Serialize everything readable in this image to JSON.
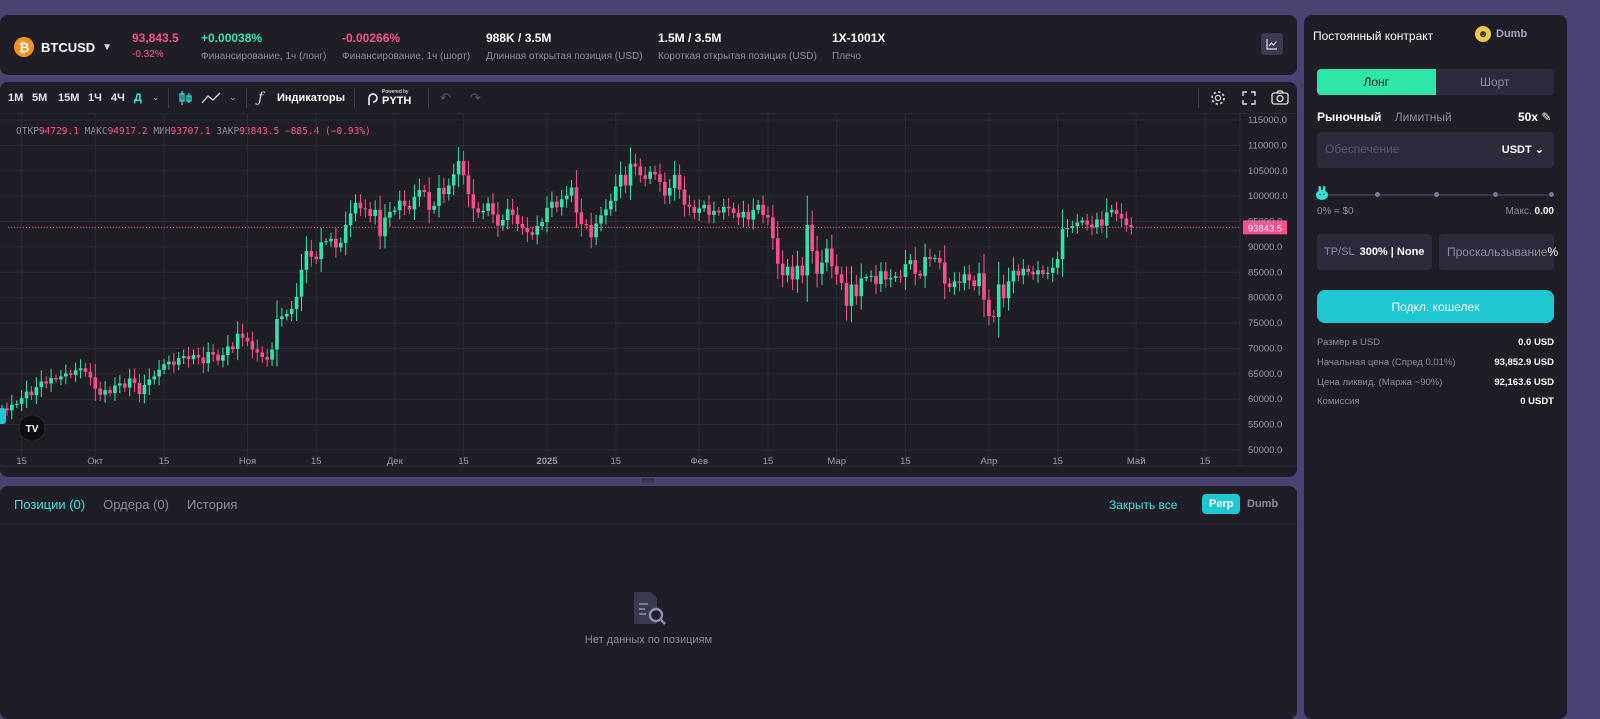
{
  "topbar": {
    "symbol": "BTCUSD",
    "price": "93,843.5",
    "change": "-0.32%",
    "funding_long": {
      "value": "+0.00038%",
      "label": "Финансирование, 1ч (лонг)"
    },
    "funding_short": {
      "value": "-0.00266%",
      "label": "Финансирование, 1ч (шорт)"
    },
    "long_oi": {
      "value": "988K / 3.5M",
      "label": "Длинная открытая позиция (USD)"
    },
    "short_oi": {
      "value": "1.5M / 3.5M",
      "label": "Короткая открытая позиция (USD)"
    },
    "leverage": {
      "value": "1X-1001X",
      "label": "Плечо"
    }
  },
  "toolbar": {
    "timeframes": [
      "1M",
      "5M",
      "15M",
      "1Ч",
      "4Ч",
      "Д"
    ],
    "active_timeframe": "Д",
    "indicators": "Индикаторы",
    "powered_by": "Powered by",
    "pyth": "PYTH"
  },
  "ohlc": {
    "o_label": "ОТКР",
    "o": "94729.1",
    "h_label": "МАКС",
    "h": "94917.2",
    "l_label": "МИН",
    "l": "93707.1",
    "c_label": "ЗАКР",
    "c": "93843.5",
    "chg": "−885.4 (−0.93%)"
  },
  "colors": {
    "up": "#2ee6a8",
    "down": "#ff4f8b",
    "accent": "#1ec8d2"
  },
  "chart_data": {
    "type": "candlestick",
    "price_label": "93843.5",
    "ylim": [
      50000,
      115000
    ],
    "y_ticks": [
      "115000.0",
      "110000.0",
      "105000.0",
      "100000.0",
      "95000.0",
      "90000.0",
      "85000.0",
      "80000.0",
      "75000.0",
      "70000.0",
      "65000.0",
      "60000.0",
      "55000.0",
      "50000.0"
    ],
    "x_ticks": [
      {
        "label": "15",
        "i": 4
      },
      {
        "label": "Окт",
        "i": 19
      },
      {
        "label": "15",
        "i": 33
      },
      {
        "label": "Ноя",
        "i": 50
      },
      {
        "label": "15",
        "i": 64
      },
      {
        "label": "Дек",
        "i": 80
      },
      {
        "label": "15",
        "i": 94
      },
      {
        "label": "2025",
        "i": 111
      },
      {
        "label": "15",
        "i": 125
      },
      {
        "label": "Фев",
        "i": 142
      },
      {
        "label": "15",
        "i": 156
      },
      {
        "label": "Мар",
        "i": 170
      },
      {
        "label": "15",
        "i": 184
      },
      {
        "label": "Апр",
        "i": 201
      },
      {
        "label": "15",
        "i": 215
      },
      {
        "label": "Май",
        "i": 231
      },
      {
        "label": "15",
        "i": 245
      }
    ],
    "closes": [
      58200,
      57800,
      58900,
      59100,
      60200,
      61500,
      60800,
      62400,
      63500,
      63100,
      64200,
      63900,
      64500,
      65100,
      64800,
      65700,
      66100,
      65400,
      64300,
      62100,
      60900,
      61800,
      61200,
      62700,
      63100,
      62300,
      64100,
      63200,
      61000,
      62800,
      63900,
      64500,
      65800,
      66900,
      67400,
      66800,
      68100,
      68500,
      67900,
      68700,
      68200,
      67100,
      69300,
      68800,
      67600,
      68700,
      70400,
      69900,
      72900,
      72100,
      71400,
      69800,
      69200,
      68300,
      67800,
      69800,
      75800,
      76300,
      76800,
      77800,
      80200,
      85500,
      89200,
      88100,
      87600,
      90900,
      91100,
      91600,
      89900,
      90800,
      94300,
      96600,
      98700,
      97600,
      97400,
      96100,
      97300,
      92100,
      95800,
      96900,
      97200,
      99100,
      98100,
      97400,
      99900,
      101200,
      100800,
      97300,
      98100,
      101600,
      100400,
      102100,
      104300,
      106900,
      104100,
      100400,
      97600,
      96800,
      97100,
      98600,
      96400,
      94200,
      95300,
      97400,
      96300,
      94500,
      93800,
      92900,
      92400,
      94100,
      94900,
      97700,
      98900,
      97800,
      99400,
      100100,
      101700,
      96800,
      94500,
      94300,
      91900,
      94600,
      96200,
      97400,
      99100,
      101900,
      104200,
      102100,
      106400,
      105800,
      104100,
      103400,
      104800,
      104300,
      102800,
      100100,
      101600,
      104200,
      101300,
      98300,
      97900,
      96700,
      97600,
      98300,
      96300,
      97100,
      96800,
      97900,
      97600,
      96700,
      95800,
      96900,
      95400,
      97300,
      98300,
      96300,
      95800,
      91700,
      86700,
      84400,
      86100,
      83600,
      86300,
      84400,
      94300,
      89200,
      84700,
      86900,
      89700,
      86200,
      84600,
      82900,
      78400,
      82600,
      80300,
      83800,
      84100,
      84300,
      82700,
      85200,
      83600,
      83900,
      84200,
      84100,
      86600,
      87400,
      84700,
      84300,
      88000,
      87600,
      87800,
      86900,
      82800,
      82100,
      83200,
      82900,
      84600,
      83400,
      82300,
      84800,
      79600,
      76400,
      76200,
      82600,
      79900,
      83200,
      85300,
      84400,
      85700,
      85100,
      84600,
      85400,
      84700,
      84900,
      85900,
      87600,
      93500,
      93700,
      94100,
      94800,
      95200,
      94400,
      93800,
      95400,
      94200,
      96800,
      97300,
      96500,
      95600,
      94300,
      93843.5
    ]
  },
  "bottom": {
    "tabs": [
      "Позиции (0)",
      "Ордера (0)",
      "История"
    ],
    "close_all": "Закрыть все",
    "pill_on": "Perp",
    "pill_off": "Dumb",
    "empty": "Нет данных по позициям"
  },
  "right": {
    "title": "Постоянный контракт",
    "user": "Dumb",
    "long": "Лонг",
    "short": "Шорт",
    "market": "Рыночный",
    "limit": "Лимитный",
    "leverage": "50x",
    "collateral_placeholder": "Обеспечение",
    "currency": "USDT",
    "slider_value": 0,
    "slider_min_label": "0% ≈ $0",
    "slider_max_label": "Макс.",
    "slider_max_value": "0.00",
    "tpsl_label": "TP/SL",
    "tpsl_value": "300% | None",
    "slippage_label": "Проскальзывание",
    "slippage_unit": "%",
    "connect": "Подкл. кошелек",
    "info": [
      {
        "k": "Размер в USD",
        "v": "0.0 USD"
      },
      {
        "k": "Начальная цена (Спред 0.01%)",
        "v": "93,852.9 USD"
      },
      {
        "k": "Цена ликвид. (Маржа ~90%)",
        "v": "92,163.6 USD"
      },
      {
        "k": "Комиссия",
        "v": "0 USDT"
      }
    ]
  }
}
